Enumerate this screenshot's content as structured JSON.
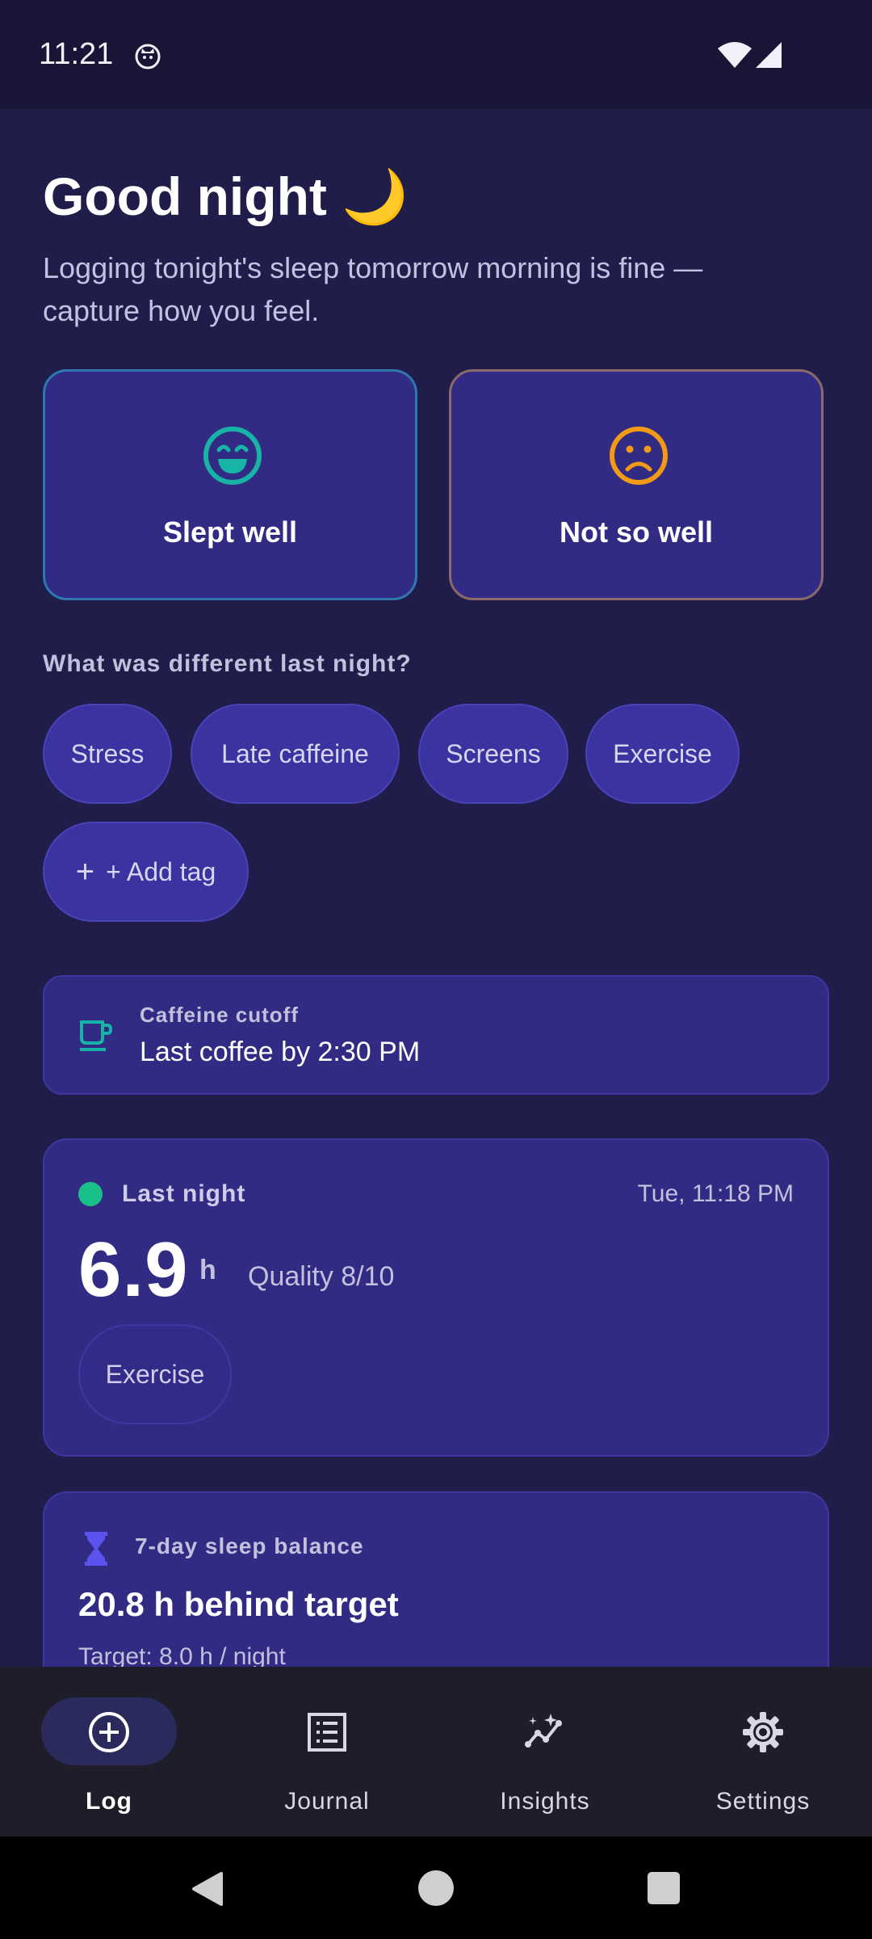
{
  "status": {
    "time": "11:21"
  },
  "header": {
    "title": "Good night 🌙",
    "subtitle": "Logging tonight's sleep tomorrow morning is fine — capture how you feel."
  },
  "mood": {
    "good_label": "Slept well",
    "bad_label": "Not so well"
  },
  "tags": {
    "question": "What was different last night?",
    "items": [
      "Stress",
      "Late caffeine",
      "Screens",
      "Exercise"
    ],
    "add_label": "+ Add tag"
  },
  "caffeine": {
    "label": "Caffeine cutoff",
    "value": "Last coffee by 2:30 PM"
  },
  "last_night": {
    "label": "Last night",
    "date": "Tue, 11:18 PM",
    "hours": "6.9",
    "unit": "h",
    "quality": "Quality 8/10",
    "tag": "Exercise"
  },
  "balance": {
    "label": "7-day sleep balance",
    "title": "20.8 h behind target",
    "target": "Target: 8.0 h / night"
  },
  "nav": {
    "items": [
      {
        "label": "Log",
        "icon": "add-circle-icon"
      },
      {
        "label": "Journal",
        "icon": "list-icon"
      },
      {
        "label": "Insights",
        "icon": "insights-icon"
      },
      {
        "label": "Settings",
        "icon": "gear-icon"
      }
    ]
  },
  "colors": {
    "background": "#201d4a",
    "card": "#312b84",
    "good_accent": "#17b3a6",
    "bad_accent": "#f29a16",
    "status_dot": "#19c08a"
  }
}
